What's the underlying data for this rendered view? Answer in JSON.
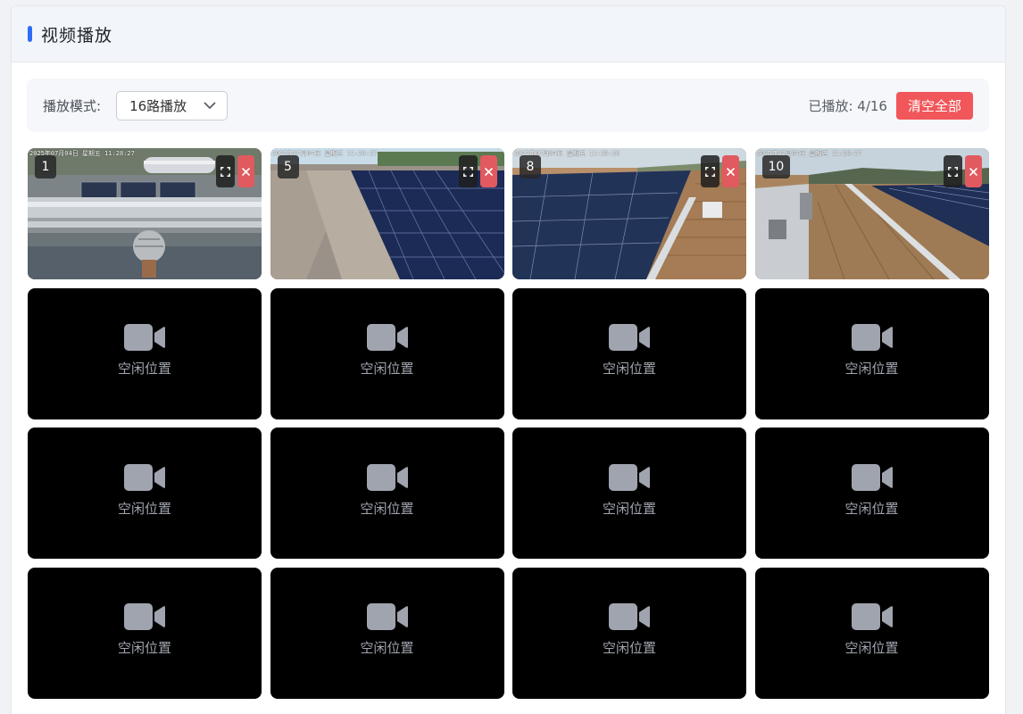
{
  "header": {
    "title": "视频播放"
  },
  "toolbar": {
    "mode_label": "播放模式:",
    "mode_value": "16路播放",
    "played_text": "已播放: 4/16",
    "clear_label": "清空全部"
  },
  "grid": {
    "empty_label": "空闲位置",
    "cells": [
      {
        "status": "playing",
        "channel": "1",
        "osd": "2025年07月04日 星期五 11:28:27",
        "scene": "rooftop-ducts"
      },
      {
        "status": "playing",
        "channel": "5",
        "osd": "2025年07月04日 星期五 11:28:27",
        "scene": "solar-roof"
      },
      {
        "status": "playing",
        "channel": "8",
        "osd": "2025年07月04日 星期五 11:28:28",
        "scene": "solar-roof-metal"
      },
      {
        "status": "playing",
        "channel": "10",
        "osd": "2025年07月04日 星期五 11:28:27",
        "scene": "solar-roof-walkway"
      },
      {
        "status": "empty"
      },
      {
        "status": "empty"
      },
      {
        "status": "empty"
      },
      {
        "status": "empty"
      },
      {
        "status": "empty"
      },
      {
        "status": "empty"
      },
      {
        "status": "empty"
      },
      {
        "status": "empty"
      },
      {
        "status": "empty"
      },
      {
        "status": "empty"
      },
      {
        "status": "empty"
      },
      {
        "status": "empty"
      }
    ]
  },
  "colors": {
    "accent": "#2d6df6",
    "danger": "#f0565a",
    "empty_cell_bg": "#000000",
    "empty_icon": "#a0a4ae"
  },
  "icons": {
    "mode_dropdown": "chevron-down-icon",
    "empty_cell": "video-camera-icon",
    "fullscreen": "fullscreen-icon",
    "close": "close-icon"
  }
}
